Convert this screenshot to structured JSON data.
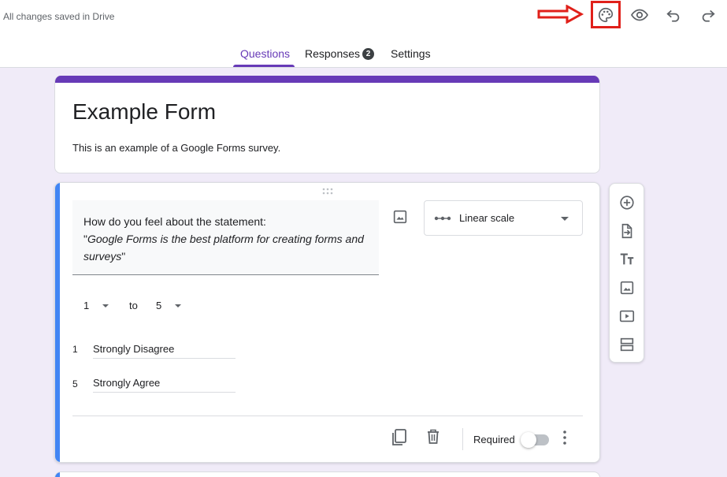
{
  "header": {
    "save_status": "All changes saved in Drive",
    "icons": [
      "palette-icon",
      "eye-icon",
      "undo-icon",
      "redo-icon"
    ]
  },
  "tabs": [
    {
      "label": "Questions",
      "active": true
    },
    {
      "label": "Responses",
      "badge": "2"
    },
    {
      "label": "Settings"
    }
  ],
  "form": {
    "title": "Example Form",
    "description": "This is an example of a Google Forms survey."
  },
  "question": {
    "line1": "How do you feel about the statement:",
    "quote_open": "\"",
    "quote_text": "Google Forms is the best platform for creating forms and surveys",
    "quote_close": "\"",
    "type": "Linear scale",
    "range_min": "1",
    "range_to": "to",
    "range_max": "5",
    "scale": [
      {
        "num": "1",
        "label": "Strongly Disagree"
      },
      {
        "num": "5",
        "label": "Strongly Agree"
      }
    ],
    "required_label": "Required",
    "required": false
  },
  "colors": {
    "accent": "#673ab7",
    "active_question": "#4285f4",
    "background": "#f0ebf8",
    "annotation": "#e0201a"
  }
}
